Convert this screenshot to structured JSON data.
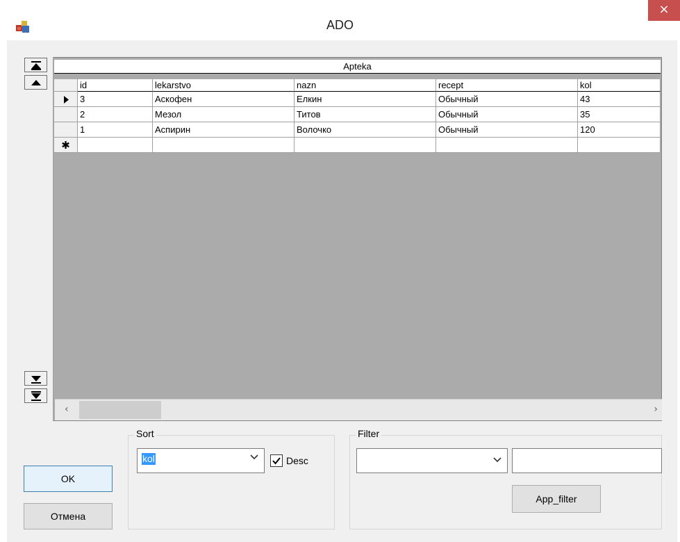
{
  "window": {
    "title": "ADO",
    "close_glyph": "×",
    "app_icon": "database-cubes-icon"
  },
  "grid": {
    "caption": "Apteka",
    "columns": [
      "id",
      "lekarstvo",
      "nazn",
      "recept",
      "kol"
    ],
    "rows": [
      {
        "indicator": "current-row",
        "cells": [
          "3",
          "Аскофен",
          "Елкин",
          "Обычный",
          "43"
        ]
      },
      {
        "indicator": "",
        "cells": [
          "2",
          "Мезол",
          "Титов",
          "Обычный",
          "35"
        ]
      },
      {
        "indicator": "",
        "cells": [
          "1",
          "Аспирин",
          "Волочко",
          "Обычный",
          "120"
        ]
      }
    ],
    "new_row_marker": "✱",
    "nav_buttons": [
      "first-record-icon",
      "prior-record-icon",
      "next-record-icon",
      "last-record-icon"
    ],
    "hscroll": {
      "left_arrow": "‹",
      "right_arrow": "›"
    }
  },
  "sort": {
    "group_label": "Sort",
    "field_value": "kol",
    "desc_label": "Desc",
    "desc_checked": true
  },
  "filter": {
    "group_label": "Filter",
    "field_value": "",
    "text_value": "",
    "apply_label": "App_filter"
  },
  "buttons": {
    "ok_label": "OK",
    "cancel_label": "Отмена"
  },
  "colors": {
    "close_button": "#c7504f",
    "selection": "#3399ff",
    "default_button_border": "#3c7fb1"
  }
}
